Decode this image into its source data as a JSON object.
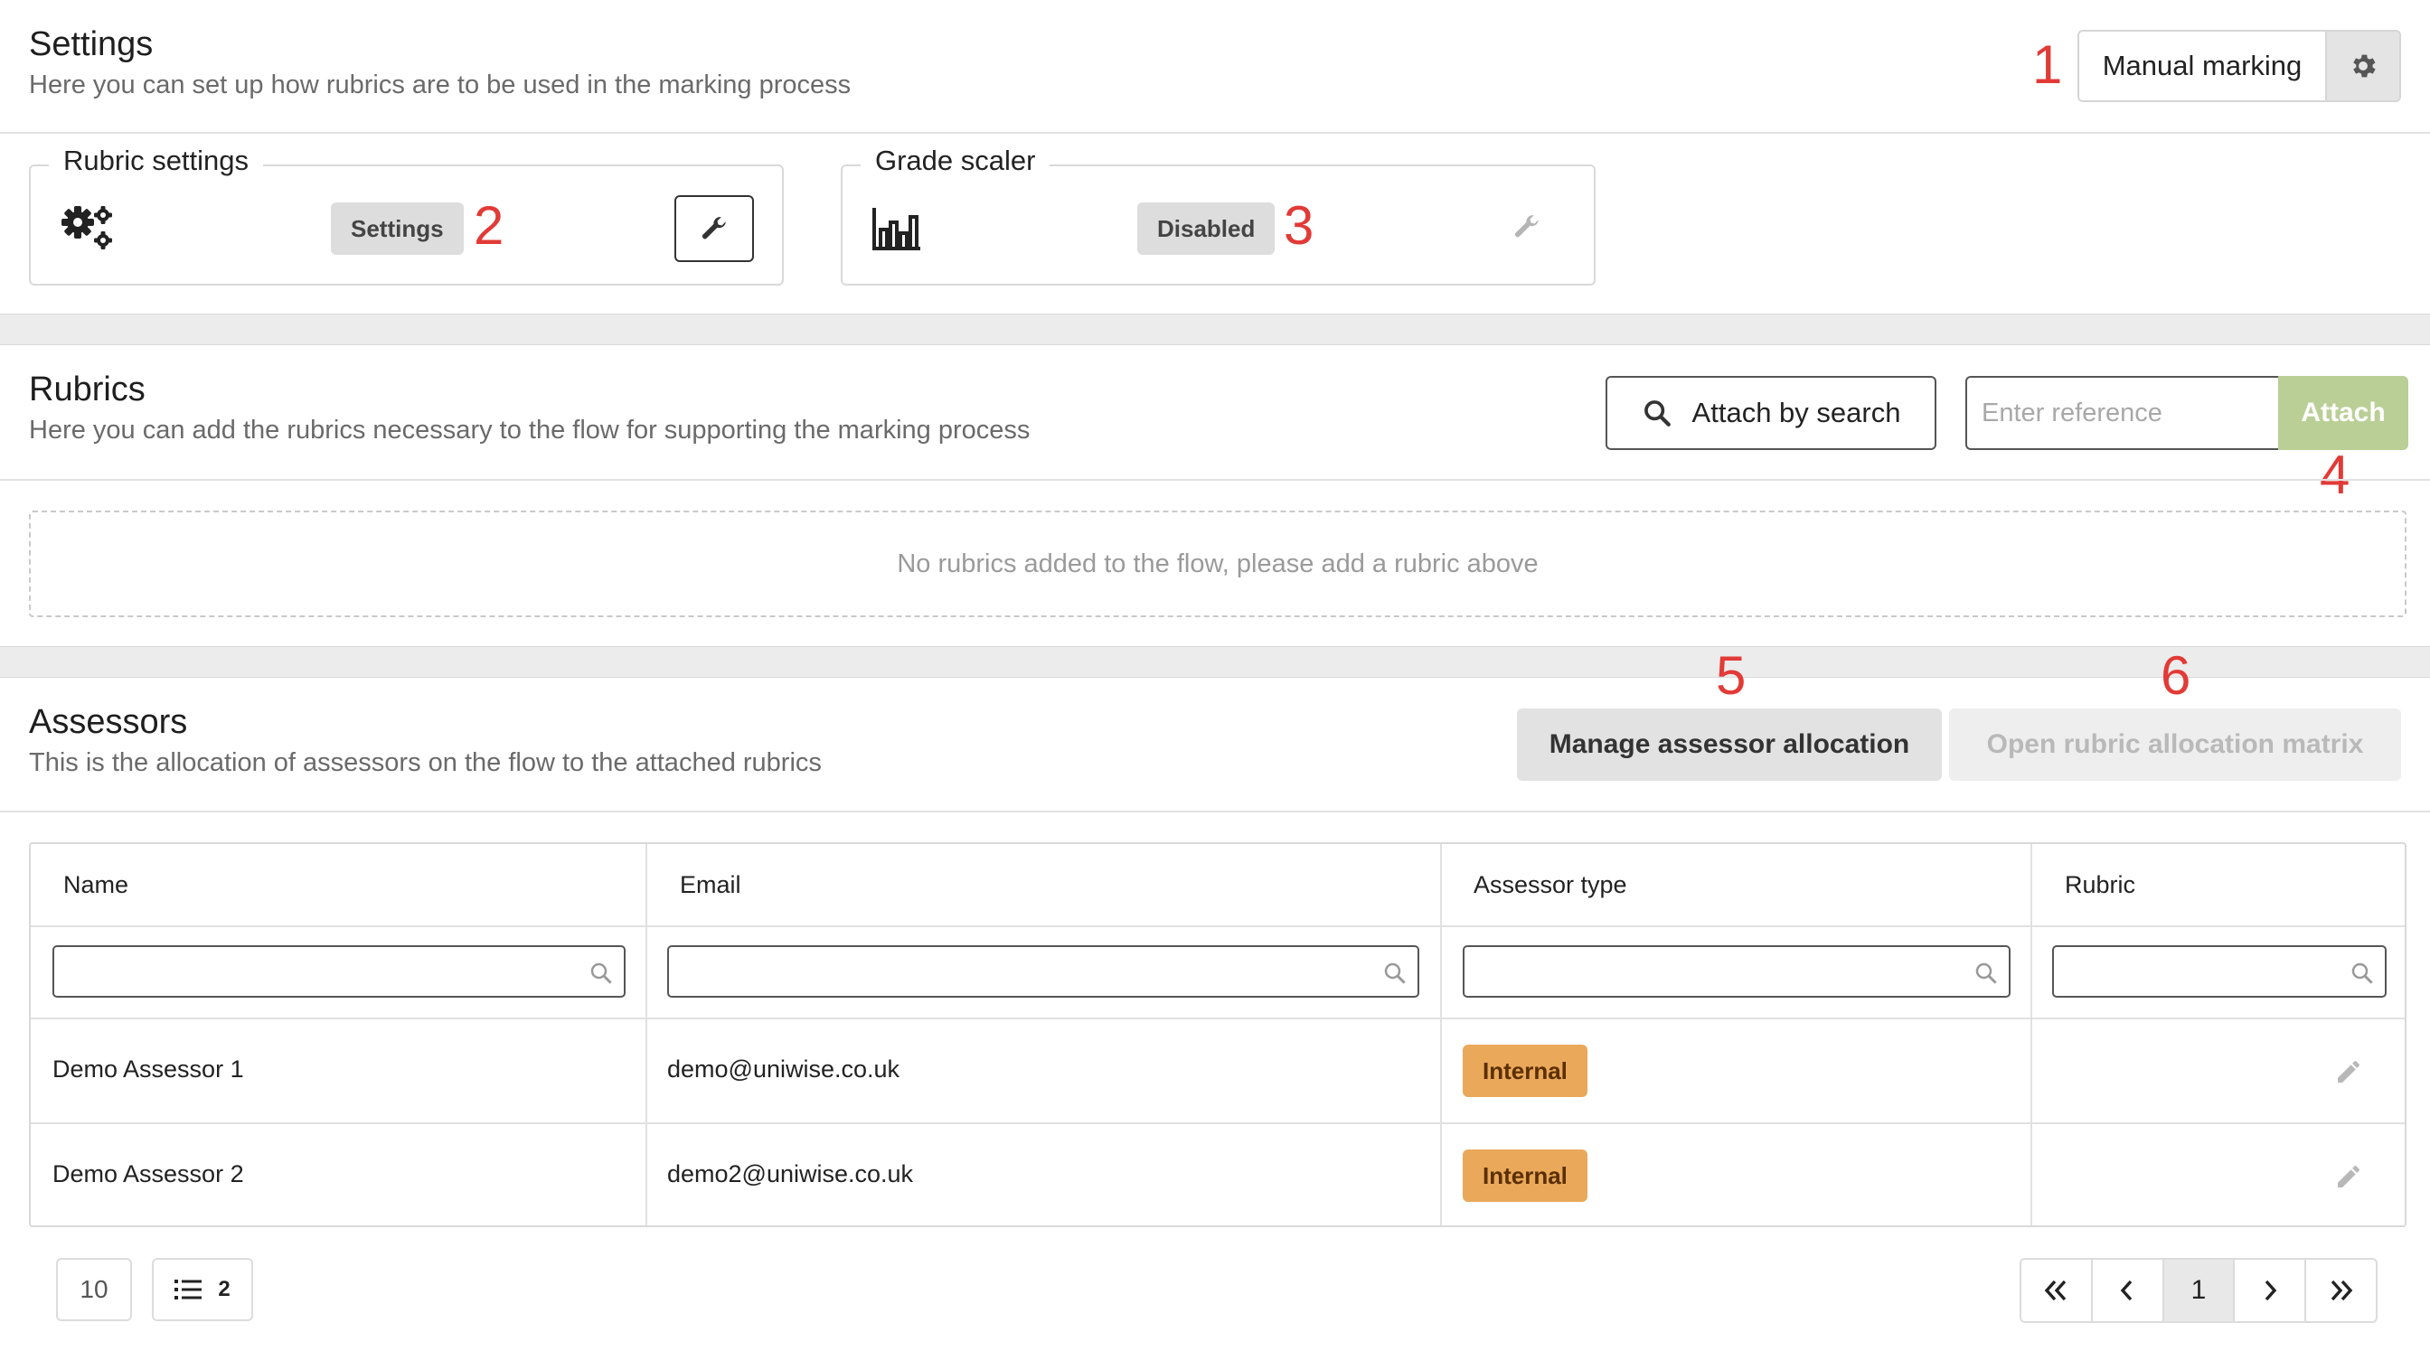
{
  "settings": {
    "title": "Settings",
    "subtitle": "Here you can set up how rubrics are to be used in the marking process",
    "mode_label": "Manual marking",
    "rubric_settings": {
      "legend": "Rubric settings",
      "pill": "Settings"
    },
    "grade_scaler": {
      "legend": "Grade scaler",
      "pill": "Disabled"
    }
  },
  "rubrics": {
    "title": "Rubrics",
    "subtitle": "Here you can add the rubrics necessary to the flow for supporting the marking process",
    "search_label": "Attach by search",
    "reference_placeholder": "Enter reference",
    "attach_label": "Attach",
    "empty_message": "No rubrics added to the flow, please add a rubric above"
  },
  "assessors": {
    "title": "Assessors",
    "subtitle": "This is the allocation of assessors on the flow to the attached rubrics",
    "manage_label": "Manage assessor allocation",
    "matrix_label": "Open rubric allocation matrix",
    "columns": [
      "Name",
      "Email",
      "Assessor type",
      "Rubric"
    ],
    "rows": [
      {
        "name": "Demo Assessor 1",
        "email": "demo@uniwise.co.uk",
        "type": "Internal",
        "rubric": ""
      },
      {
        "name": "Demo Assessor 2",
        "email": "demo2@uniwise.co.uk",
        "type": "Internal",
        "rubric": ""
      }
    ],
    "page_size": "10",
    "list_count": "2",
    "current_page": "1"
  },
  "annotations": [
    "1",
    "2",
    "3",
    "4",
    "5",
    "6"
  ],
  "colors": {
    "accent_attach": "#b9cf96",
    "badge_internal": "#eaa85a",
    "annotation": "#e23a36"
  },
  "icons": [
    "gear-icon",
    "gears-icon",
    "wrench-icon",
    "bar-chart-icon",
    "search-icon",
    "pencil-icon",
    "list-icon"
  ]
}
